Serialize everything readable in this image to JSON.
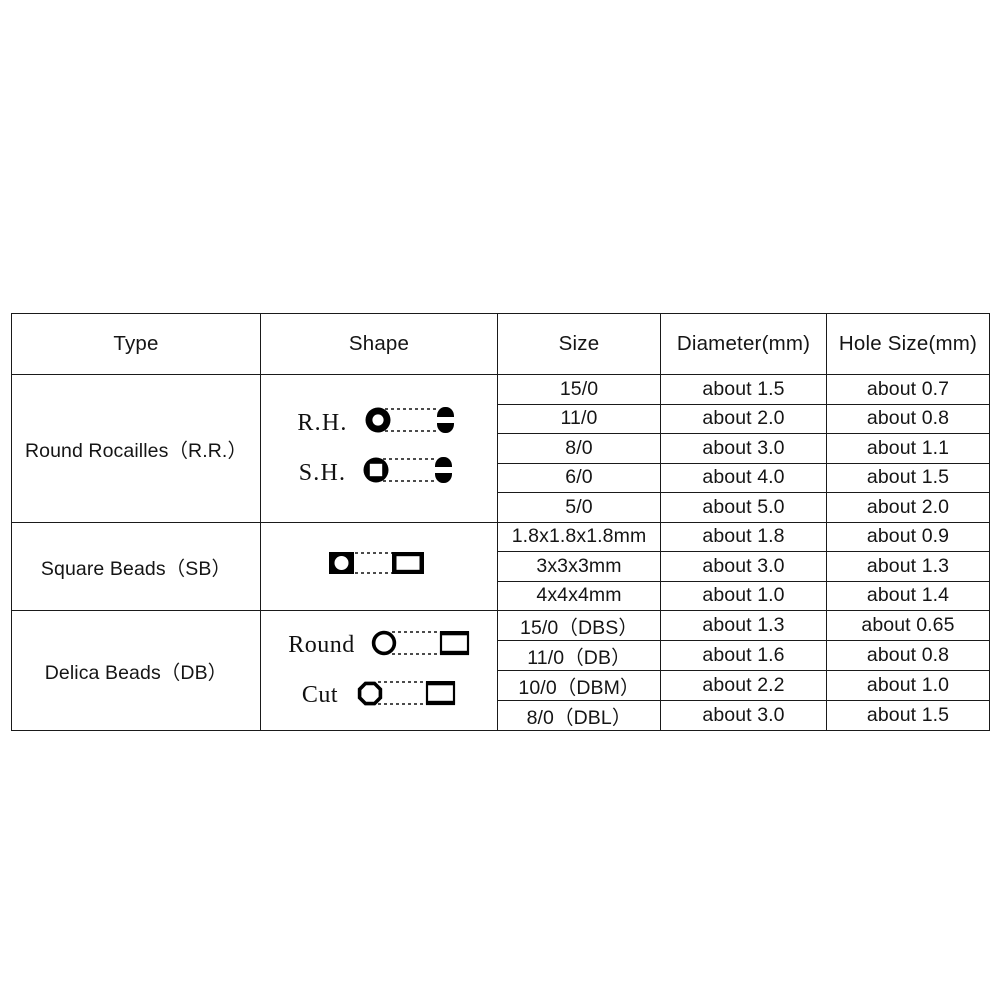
{
  "table": {
    "headers": {
      "type": "Type",
      "shape": "Shape",
      "size": "Size",
      "diameter": "Diameter(mm)",
      "hole": "Hole Size(mm)"
    },
    "groups": [
      {
        "type_label": "Round Rocailles（R.R.）",
        "shape_labels": [
          "R.H.",
          "S.H."
        ],
        "shape_icons": [
          "round-hole-bead-front-and-side",
          "square-hole-bead-front-and-side"
        ],
        "rows": [
          {
            "size": "15/0",
            "diameter": "about 1.5",
            "hole": "about 0.7"
          },
          {
            "size": "11/0",
            "diameter": "about 2.0",
            "hole": "about 0.8"
          },
          {
            "size": "8/0",
            "diameter": "about 3.0",
            "hole": "about 1.1"
          },
          {
            "size": "6/0",
            "diameter": "about 4.0",
            "hole": "about 1.5"
          },
          {
            "size": "5/0",
            "diameter": "about 5.0",
            "hole": "about 2.0"
          }
        ]
      },
      {
        "type_label": "Square Beads（SB）",
        "shape_labels": [],
        "shape_icons": [
          "square-bead-front-and-side"
        ],
        "rows": [
          {
            "size": "1.8x1.8x1.8mm",
            "diameter": "about 1.8",
            "hole": "about 0.9"
          },
          {
            "size": "3x3x3mm",
            "diameter": "about 3.0",
            "hole": "about 1.3"
          },
          {
            "size": "4x4x4mm",
            "diameter": "about 1.0",
            "hole": "about 1.4"
          }
        ]
      },
      {
        "type_label": "Delica Beads（DB）",
        "shape_labels": [
          "Round",
          "Cut"
        ],
        "shape_icons": [
          "delica-round-bead-front-and-side",
          "delica-cut-bead-front-and-side"
        ],
        "rows": [
          {
            "size": "15/0（DBS）",
            "diameter": "about 1.3",
            "hole": "about 0.65"
          },
          {
            "size": "11/0（DB）",
            "diameter": "about 1.6",
            "hole": "about 0.8"
          },
          {
            "size": "10/0（DBM）",
            "diameter": "about 2.2",
            "hole": "about 1.0"
          },
          {
            "size": "8/0（DBL）",
            "diameter": "about 3.0",
            "hole": "about 1.5"
          }
        ]
      }
    ]
  },
  "colors": {
    "ink": "#151515",
    "rule": "#1a1a1a",
    "background": "#ffffff"
  }
}
